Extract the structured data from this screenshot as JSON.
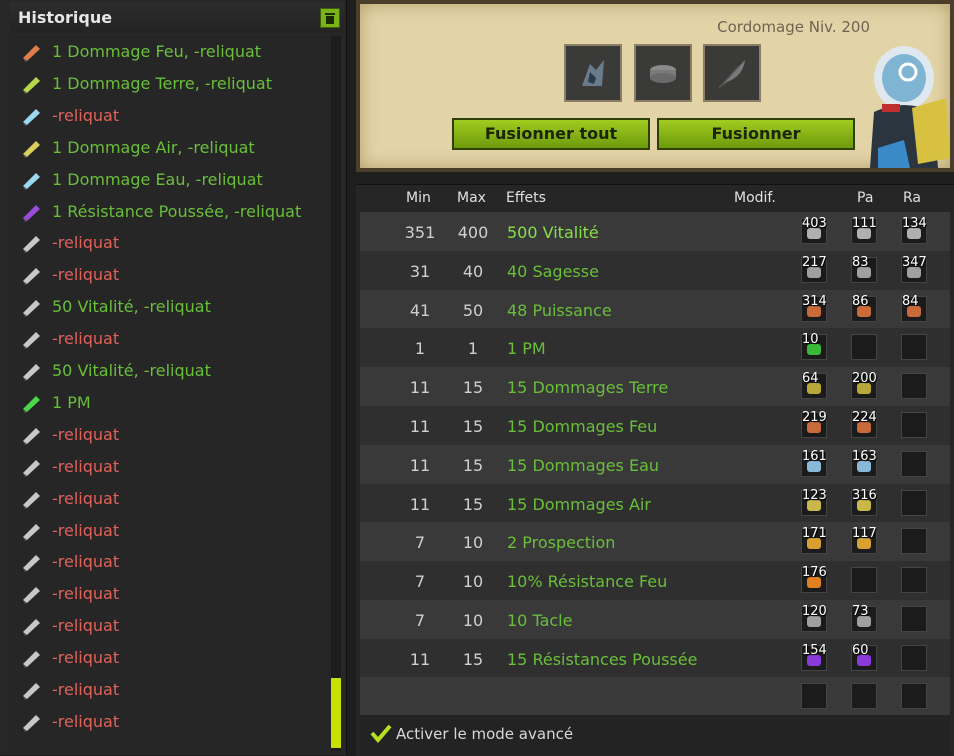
{
  "history": {
    "title": "Historique",
    "items": [
      {
        "text": "1 Dommage Feu, -reliquat",
        "color": "green",
        "icon": "fire-rune-icon",
        "tint": "#e07b4a"
      },
      {
        "text": "1 Dommage Terre, -reliquat",
        "color": "green",
        "icon": "earth-rune-icon",
        "tint": "#b6d84a"
      },
      {
        "text": "-reliquat",
        "color": "red",
        "icon": "water-rune-icon",
        "tint": "#9ad8f0"
      },
      {
        "text": "1 Dommage Air, -reliquat",
        "color": "green",
        "icon": "air-rune-icon",
        "tint": "#d8d05a"
      },
      {
        "text": "1 Dommage Eau, -reliquat",
        "color": "green",
        "icon": "water-rune-icon",
        "tint": "#9ad8f0"
      },
      {
        "text": "1 Résistance Poussée, -reliquat",
        "color": "green",
        "icon": "pushback-rune-icon",
        "tint": "#9a4ad8"
      },
      {
        "text": "-reliquat",
        "color": "red",
        "icon": "vitality-rune-icon",
        "tint": "#c8c8c8"
      },
      {
        "text": "-reliquat",
        "color": "red",
        "icon": "vitality-rune-icon",
        "tint": "#c8c8c8"
      },
      {
        "text": "50 Vitalité, -reliquat",
        "color": "green",
        "icon": "vitality-rune-icon",
        "tint": "#c8c8c8"
      },
      {
        "text": "-reliquat",
        "color": "red",
        "icon": "vitality-rune-icon",
        "tint": "#c8c8c8"
      },
      {
        "text": "50 Vitalité, -reliquat",
        "color": "green",
        "icon": "vitality-rune-icon",
        "tint": "#c8c8c8"
      },
      {
        "text": "1 PM",
        "color": "green",
        "icon": "pm-rune-icon",
        "tint": "#4ad84a"
      },
      {
        "text": "-reliquat",
        "color": "red",
        "icon": "vitality-rune-icon",
        "tint": "#c8c8c8"
      },
      {
        "text": "-reliquat",
        "color": "red",
        "icon": "vitality-rune-icon",
        "tint": "#c8c8c8"
      },
      {
        "text": "-reliquat",
        "color": "red",
        "icon": "vitality-rune-icon",
        "tint": "#c8c8c8"
      },
      {
        "text": "-reliquat",
        "color": "red",
        "icon": "vitality-rune-icon",
        "tint": "#c8c8c8"
      },
      {
        "text": "-reliquat",
        "color": "red",
        "icon": "vitality-rune-icon",
        "tint": "#c8c8c8"
      },
      {
        "text": "-reliquat",
        "color": "red",
        "icon": "vitality-rune-icon",
        "tint": "#c8c8c8"
      },
      {
        "text": "-reliquat",
        "color": "red",
        "icon": "vitality-rune-icon",
        "tint": "#c8c8c8"
      },
      {
        "text": "-reliquat",
        "color": "red",
        "icon": "vitality-rune-icon",
        "tint": "#c8c8c8"
      },
      {
        "text": "-reliquat",
        "color": "red",
        "icon": "vitality-rune-icon",
        "tint": "#c8c8c8"
      },
      {
        "text": "-reliquat",
        "color": "red",
        "icon": "vitality-rune-icon",
        "tint": "#c8c8c8"
      }
    ]
  },
  "forge": {
    "level": "Cordomage Niv. 200",
    "slots": [
      "item-slot-icon",
      "rune-slot-icon",
      "feather-slot-icon"
    ],
    "fuse_all": "Fusionner tout",
    "fuse": "Fusionner"
  },
  "table": {
    "headers": {
      "min": "Min",
      "max": "Max",
      "effects": "Effets",
      "modif": "Modif.",
      "pa": "Pa",
      "ra": "Ra"
    },
    "rows": [
      {
        "min": "351",
        "max": "400",
        "effect": "500 Vitalité",
        "bright": true,
        "ba": "403",
        "pa": "111",
        "ra": "134",
        "tint": "#b0b0b0"
      },
      {
        "min": "31",
        "max": "40",
        "effect": "40 Sagesse",
        "ba": "217",
        "pa": "83",
        "ra": "347",
        "tint": "#a0a0a0"
      },
      {
        "min": "41",
        "max": "50",
        "effect": "48 Puissance",
        "ba": "314",
        "pa": "86",
        "ra": "84",
        "tint": "#c86a3a"
      },
      {
        "min": "1",
        "max": "1",
        "effect": "1 PM",
        "ba": "10",
        "pa": "",
        "ra": "",
        "tint": "#3ab83a"
      },
      {
        "min": "11",
        "max": "15",
        "effect": "15 Dommages Terre",
        "ba": "64",
        "pa": "200",
        "ra": "",
        "tint": "#b8a83a"
      },
      {
        "min": "11",
        "max": "15",
        "effect": "15 Dommages Feu",
        "ba": "219",
        "pa": "224",
        "ra": "",
        "tint": "#c86a3a"
      },
      {
        "min": "11",
        "max": "15",
        "effect": "15 Dommages Eau",
        "ba": "161",
        "pa": "163",
        "ra": "",
        "tint": "#8ab8d8"
      },
      {
        "min": "11",
        "max": "15",
        "effect": "15 Dommages Air",
        "ba": "123",
        "pa": "316",
        "ra": "",
        "tint": "#c8b84a"
      },
      {
        "min": "7",
        "max": "10",
        "effect": "2 Prospection",
        "ba": "171",
        "pa": "117",
        "ra": "",
        "tint": "#d8a030"
      },
      {
        "min": "7",
        "max": "10",
        "effect": "10% Résistance Feu",
        "ba": "176",
        "pa": "",
        "ra": "",
        "tint": "#e08020"
      },
      {
        "min": "7",
        "max": "10",
        "effect": "10 Tacle",
        "ba": "120",
        "pa": "73",
        "ra": "",
        "tint": "#a0a0a0"
      },
      {
        "min": "11",
        "max": "15",
        "effect": "15 Résistances Poussée",
        "ba": "154",
        "pa": "60",
        "ra": "",
        "tint": "#8a3ad8"
      }
    ],
    "advanced_mode": "Activer le mode avancé"
  }
}
